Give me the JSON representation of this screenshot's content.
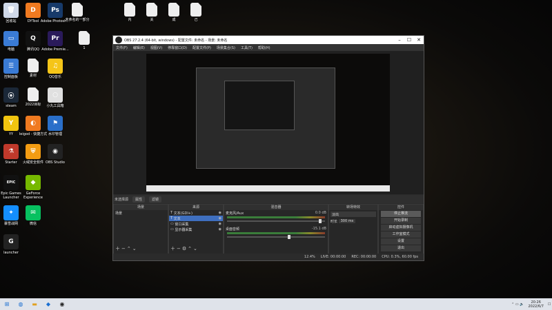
{
  "desktop": {
    "icons": [
      {
        "label": "回收站",
        "color": "#cfd8e8",
        "glyph": "🗑"
      },
      {
        "label": "DYTool",
        "color": "#f07a20",
        "glyph": "D"
      },
      {
        "label": "Adobe Photosh...",
        "color": "#173a6a",
        "glyph": "Ps"
      },
      {
        "label": "电脑",
        "color": "#3a7bd5",
        "glyph": "▭"
      },
      {
        "label": "腾讯QQ",
        "color": "#111",
        "glyph": "Q"
      },
      {
        "label": "Adobe Premie...",
        "color": "#2a1a5a",
        "glyph": "Pr"
      },
      {
        "label": "控制面板",
        "color": "#3a7bd5",
        "glyph": "☰"
      },
      {
        "label": "素材",
        "color": "#eee",
        "glyph": ""
      },
      {
        "label": "QQ音乐",
        "color": "#f5c518",
        "glyph": "♫"
      },
      {
        "label": "steam",
        "color": "#1b2838",
        "glyph": "⦿"
      },
      {
        "label": "2022目标",
        "color": "#eee",
        "glyph": ""
      },
      {
        "label": "小丸工具箱",
        "color": "#e0e0e0",
        "glyph": "○"
      },
      {
        "label": "YY",
        "color": "#f1c40f",
        "glyph": "Y"
      },
      {
        "label": "leigod - 快捷方式",
        "color": "#f07a20",
        "glyph": "◐"
      },
      {
        "label": "水印管理",
        "color": "#2a6fc9",
        "glyph": "⚑"
      },
      {
        "label": "Starter",
        "color": "#c0392b",
        "glyph": "⚗"
      },
      {
        "label": "火绒安全软件",
        "color": "#f39c12",
        "glyph": "⛨"
      },
      {
        "label": "OBS Studio",
        "color": "#222",
        "glyph": "◉"
      },
      {
        "label": "Epic Games Launcher",
        "color": "#111",
        "glyph": "EPIC"
      },
      {
        "label": "GeForce Experience",
        "color": "#76b900",
        "glyph": "◆"
      },
      {
        "label": "暴雪战网",
        "color": "#148eff",
        "glyph": "✦"
      },
      {
        "label": "微信",
        "color": "#07c160",
        "glyph": "✉"
      },
      {
        "label": "launcher",
        "color": "#222",
        "glyph": "G"
      }
    ],
    "top_files": [
      "未命名的一部分",
      "1",
      "内",
      "关",
      "成",
      "己"
    ]
  },
  "obs": {
    "title": "OBS 27.2.4 (64-bit, windows) - 配置文件: 未命名 - 场景: 未命名",
    "menu": [
      "文件(F)",
      "编辑(E)",
      "视图(V)",
      "停靠窗口(D)",
      "配置文件(P)",
      "场景集合(S)",
      "工具(T)",
      "帮助(H)"
    ],
    "source_bar": {
      "label": "未选择源",
      "props": "属性",
      "filters": "滤镜"
    },
    "docks": {
      "scenes": {
        "title": "场景",
        "items": [
          "场景"
        ]
      },
      "sources": {
        "title": "来源",
        "items": [
          {
            "label": "文本(GDI+)",
            "icon": "T"
          },
          {
            "label": "文本",
            "icon": "T"
          },
          {
            "label": "窗口采集",
            "icon": "▭"
          },
          {
            "label": "显示器采集",
            "icon": "▭"
          }
        ]
      },
      "mixer": {
        "title": "混音器",
        "channels": [
          {
            "name": "麦克风/Aux",
            "db": "0.0 dB",
            "level": 0.94
          },
          {
            "name": "桌面音频",
            "db": "-15.1 dB",
            "level": 0.62
          }
        ]
      },
      "transitions": {
        "title": "转场特效",
        "type": "淡出",
        "duration_label": "时长",
        "duration": "300 ms"
      },
      "controls": {
        "title": "控件",
        "buttons": [
          "停止推流",
          "开始录制",
          "启动虚拟摄像机",
          "工作室模式",
          "设置",
          "退出"
        ]
      }
    },
    "status": {
      "live": "LIVE: 00:00:00",
      "rec": "REC: 00:00:00",
      "cpu": "CPU: 0.3%, 60.00 fps",
      "dropped": "12.4%"
    }
  },
  "taskbar": {
    "time": "20:26",
    "date": "2022/6/7"
  }
}
